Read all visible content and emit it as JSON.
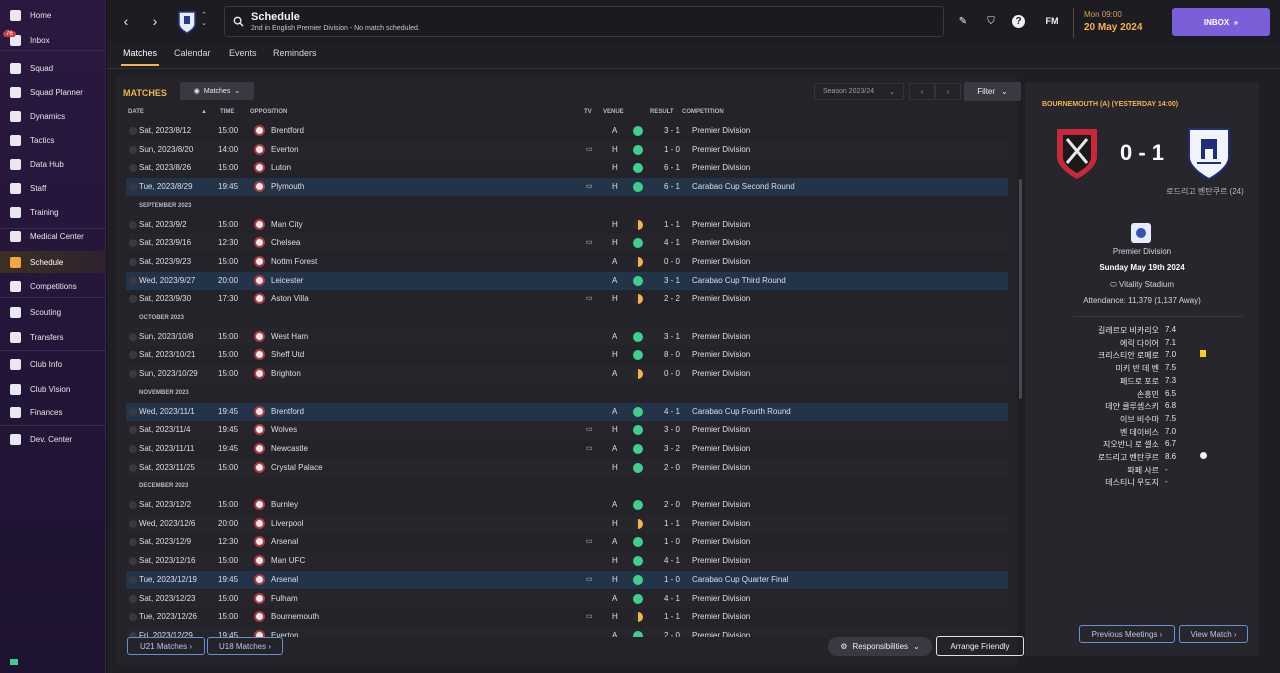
{
  "sidebar": {
    "inbox_badge": "76",
    "items": [
      {
        "label": "Home"
      },
      {
        "label": "Inbox"
      },
      {
        "label": "Squad"
      },
      {
        "label": "Squad Planner"
      },
      {
        "label": "Dynamics"
      },
      {
        "label": "Tactics"
      },
      {
        "label": "Data Hub"
      },
      {
        "label": "Staff"
      },
      {
        "label": "Training"
      },
      {
        "label": "Medical Center"
      },
      {
        "label": "Schedule"
      },
      {
        "label": "Competitions"
      },
      {
        "label": "Scouting"
      },
      {
        "label": "Transfers"
      },
      {
        "label": "Club Info"
      },
      {
        "label": "Club Vision"
      },
      {
        "label": "Finances"
      },
      {
        "label": "Dev. Center"
      }
    ]
  },
  "header": {
    "title": "Schedule",
    "subtitle": "2nd in English Premier Division - No match scheduled.",
    "fm_label": "FM",
    "day": "Mon 09:00",
    "date": "20 May 2024",
    "inbox_label": "INBOX"
  },
  "tabs": [
    "Matches",
    "Calendar",
    "Events",
    "Reminders"
  ],
  "matches": {
    "title": "MATCHES",
    "view_label": "Matches",
    "season": "Season 2023/24",
    "filter_label": "Filter",
    "columns": {
      "date": "DATE",
      "time": "TIME",
      "opposition": "OPPOSITION",
      "tv": "TV",
      "venue": "VENUE",
      "result": "RESULT",
      "competition": "COMPETITION"
    },
    "months": [
      "SEPTEMBER 2023",
      "OCTOBER 2023",
      "NOVEMBER 2023",
      "DECEMBER 2023"
    ],
    "rows": [
      {
        "date": "Sat, 2023/8/12",
        "time": "15:00",
        "opp": "Brentford",
        "tv": "",
        "venue": "A",
        "result": "3 - 1",
        "comp": "Premier Division"
      },
      {
        "date": "Sun, 2023/8/20",
        "time": "14:00",
        "opp": "Everton",
        "tv": "▭",
        "venue": "H",
        "result": "1 - 0",
        "comp": "Premier Division"
      },
      {
        "date": "Sat, 2023/8/26",
        "time": "15:00",
        "opp": "Luton",
        "tv": "",
        "venue": "H",
        "result": "6 - 1",
        "comp": "Premier Division"
      },
      {
        "date": "Tue, 2023/8/29",
        "time": "19:45",
        "opp": "Plymouth",
        "tv": "▭",
        "venue": "H",
        "result": "6 - 1",
        "comp": "Carabao Cup Second Round"
      },
      {
        "date": "Sat, 2023/9/2",
        "time": "15:00",
        "opp": "Man City",
        "tv": "",
        "venue": "H",
        "result": "1 - 1",
        "comp": "Premier Division"
      },
      {
        "date": "Sat, 2023/9/16",
        "time": "12:30",
        "opp": "Chelsea",
        "tv": "▭",
        "venue": "H",
        "result": "4 - 1",
        "comp": "Premier Division"
      },
      {
        "date": "Sat, 2023/9/23",
        "time": "15:00",
        "opp": "Nottm Forest",
        "tv": "",
        "venue": "A",
        "result": "0 - 0",
        "comp": "Premier Division"
      },
      {
        "date": "Wed, 2023/9/27",
        "time": "20:00",
        "opp": "Leicester",
        "tv": "",
        "venue": "A",
        "result": "3 - 1",
        "comp": "Carabao Cup Third Round"
      },
      {
        "date": "Sat, 2023/9/30",
        "time": "17:30",
        "opp": "Aston Villa",
        "tv": "▭",
        "venue": "H",
        "result": "2 - 2",
        "comp": "Premier Division"
      },
      {
        "date": "Sun, 2023/10/8",
        "time": "15:00",
        "opp": "West Ham",
        "tv": "",
        "venue": "A",
        "result": "3 - 1",
        "comp": "Premier Division"
      },
      {
        "date": "Sat, 2023/10/21",
        "time": "15:00",
        "opp": "Sheff Utd",
        "tv": "",
        "venue": "H",
        "result": "8 - 0",
        "comp": "Premier Division"
      },
      {
        "date": "Sun, 2023/10/29",
        "time": "15:00",
        "opp": "Brighton",
        "tv": "",
        "venue": "A",
        "result": "0 - 0",
        "comp": "Premier Division"
      },
      {
        "date": "Wed, 2023/11/1",
        "time": "19:45",
        "opp": "Brentford",
        "tv": "",
        "venue": "A",
        "result": "4 - 1",
        "comp": "Carabao Cup Fourth Round"
      },
      {
        "date": "Sat, 2023/11/4",
        "time": "19:45",
        "opp": "Wolves",
        "tv": "▭",
        "venue": "H",
        "result": "3 - 0",
        "comp": "Premier Division"
      },
      {
        "date": "Sat, 2023/11/11",
        "time": "19:45",
        "opp": "Newcastle",
        "tv": "▭",
        "venue": "A",
        "result": "3 - 2",
        "comp": "Premier Division"
      },
      {
        "date": "Sat, 2023/11/25",
        "time": "15:00",
        "opp": "Crystal Palace",
        "tv": "",
        "venue": "H",
        "result": "2 - 0",
        "comp": "Premier Division"
      },
      {
        "date": "Sat, 2023/12/2",
        "time": "15:00",
        "opp": "Burnley",
        "tv": "",
        "venue": "A",
        "result": "2 - 0",
        "comp": "Premier Division"
      },
      {
        "date": "Wed, 2023/12/6",
        "time": "20:00",
        "opp": "Liverpool",
        "tv": "",
        "venue": "H",
        "result": "1 - 1",
        "comp": "Premier Division"
      },
      {
        "date": "Sat, 2023/12/9",
        "time": "12:30",
        "opp": "Arsenal",
        "tv": "▭",
        "venue": "A",
        "result": "1 - 0",
        "comp": "Premier Division"
      },
      {
        "date": "Sat, 2023/12/16",
        "time": "15:00",
        "opp": "Man UFC",
        "tv": "",
        "venue": "H",
        "result": "4 - 1",
        "comp": "Premier Division"
      },
      {
        "date": "Tue, 2023/12/19",
        "time": "19:45",
        "opp": "Arsenal",
        "tv": "▭",
        "venue": "H",
        "result": "1 - 0",
        "comp": "Carabao Cup Quarter Final"
      },
      {
        "date": "Sat, 2023/12/23",
        "time": "15:00",
        "opp": "Fulham",
        "tv": "",
        "venue": "A",
        "result": "4 - 1",
        "comp": "Premier Division"
      },
      {
        "date": "Tue, 2023/12/26",
        "time": "15:00",
        "opp": "Bournemouth",
        "tv": "▭",
        "venue": "H",
        "result": "1 - 1",
        "comp": "Premier Division"
      },
      {
        "date": "Fri, 2023/12/29",
        "time": "19:45",
        "opp": "Everton",
        "tv": "",
        "venue": "A",
        "result": "2 - 0",
        "comp": "Premier Division"
      }
    ],
    "footer": {
      "u21": "U21 Matches",
      "u18": "U18 Matches",
      "responsibilities": "Responsibilities",
      "friendly": "Arrange Friendly"
    }
  },
  "side": {
    "title": "BOURNEMOUTH (A) (YESTERDAY 14:00)",
    "score": "0 - 1",
    "scorer": "로드리고 벤탄쿠르 (24)",
    "competition": "Premier Division",
    "date": "Sunday May 19th 2024",
    "stadium": "Vitality Stadium",
    "attendance": "Attendance: 11,379 (1,137 Away)",
    "players": [
      {
        "name": "길레르모 비카리오",
        "rating": "7.4"
      },
      {
        "name": "에릭 다이어",
        "rating": "7.1"
      },
      {
        "name": "크리스티안 로메로",
        "rating": "7.0"
      },
      {
        "name": "미키 반 데 벤",
        "rating": "7.5"
      },
      {
        "name": "페드로 포로",
        "rating": "7.3"
      },
      {
        "name": "손흥민",
        "rating": "6.5"
      },
      {
        "name": "데얀 쿨루셉스키",
        "rating": "6.8"
      },
      {
        "name": "이브 비수마",
        "rating": "7.5"
      },
      {
        "name": "벤 데이비스",
        "rating": "7.0"
      },
      {
        "name": "지오반니 로 셀소",
        "rating": "6.7"
      },
      {
        "name": "로드리고 벤탄쿠르",
        "rating": "8.6"
      },
      {
        "name": "파페 사르",
        "rating": "-"
      },
      {
        "name": "데스티니 우도지",
        "rating": "-"
      }
    ],
    "prev_label": "Previous Meetings",
    "view_label": "View Match"
  }
}
